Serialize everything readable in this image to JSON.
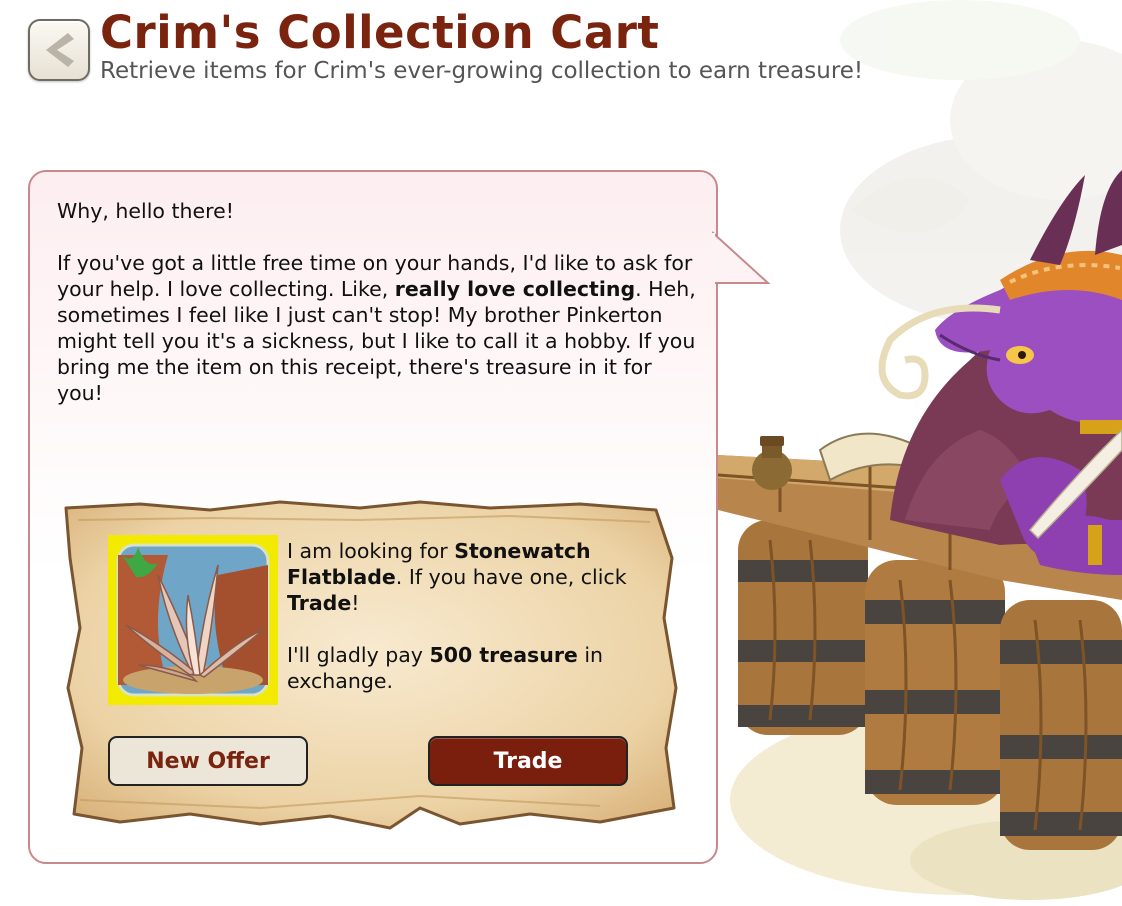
{
  "header": {
    "title": "Crim's Collection Cart",
    "subtitle": "Retrieve items for Crim's ever-growing collection to earn treasure!",
    "back_icon": "chevron-left-icon"
  },
  "dialog": {
    "greeting": "Why, hello there!",
    "body_part1": "If you've got a little free time on your hands, I'd like to ask for your help. I love collecting. Like, ",
    "body_bold": "really love collecting",
    "body_part2": ". Heh, sometimes I feel like I just can't stop! My brother Pinkerton might tell you it's a sickness, but I like to call it a hobby. If you bring me the item on this receipt, there's treasure in it for you!"
  },
  "offer": {
    "line1_prefix": "I am looking for ",
    "item_name": "Stonewatch Flatblade",
    "line1_mid": ". If you have one, click ",
    "trade_word": "Trade",
    "line1_suffix": "!",
    "line2_prefix": "I'll gladly pay ",
    "reward": "500 treasure",
    "line2_suffix": " in exchange.",
    "item_image_background": "#f2ea00"
  },
  "buttons": {
    "new_offer": "New Offer",
    "trade": "Trade"
  },
  "colors": {
    "title": "#7a2410",
    "bubble_border": "#c9898c",
    "trade_button": "#7a1f0e"
  }
}
